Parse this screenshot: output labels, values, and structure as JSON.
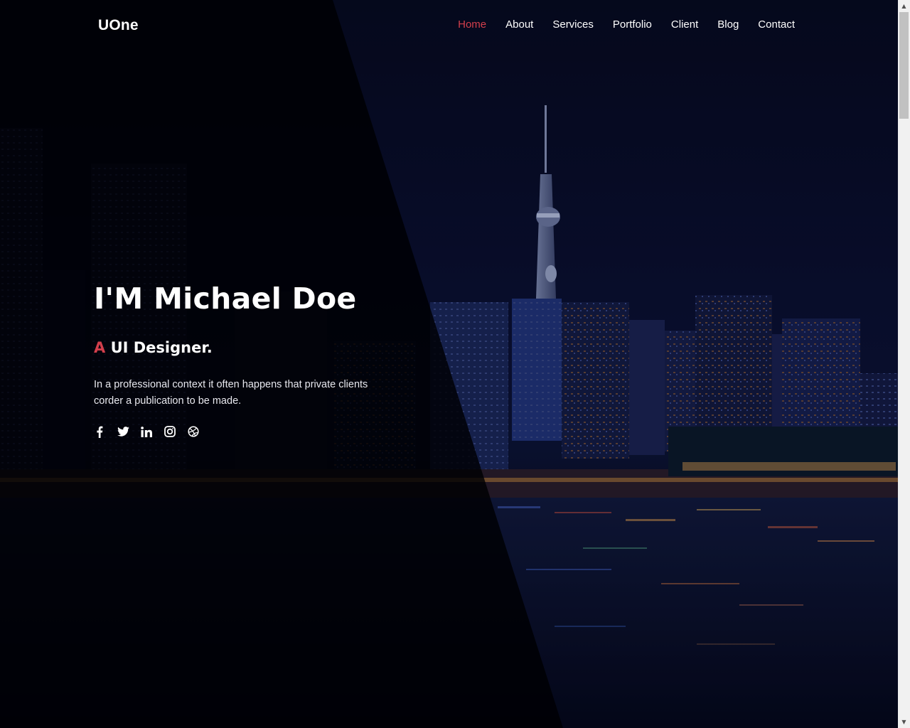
{
  "brand": {
    "logo_text": "UOne"
  },
  "nav": {
    "items": [
      {
        "label": "Home",
        "active": true
      },
      {
        "label": "About",
        "active": false
      },
      {
        "label": "Services",
        "active": false
      },
      {
        "label": "Portfolio",
        "active": false
      },
      {
        "label": "Client",
        "active": false
      },
      {
        "label": "Blog",
        "active": false
      },
      {
        "label": "Contact",
        "active": false
      }
    ]
  },
  "hero": {
    "title": "I'M Michael Doe",
    "subtitle_accent": "A",
    "subtitle_rest": "UI Designer.",
    "description": "In a professional context it often happens that private clients corder a publication to be made.",
    "social": [
      {
        "icon": "facebook-icon"
      },
      {
        "icon": "twitter-icon"
      },
      {
        "icon": "linkedin-icon"
      },
      {
        "icon": "instagram-icon"
      },
      {
        "icon": "dribbble-icon"
      }
    ]
  },
  "colors": {
    "accent": "#d33f4c",
    "text": "#ffffff",
    "background_dark": "#04060f",
    "sky": "#0a1030"
  }
}
